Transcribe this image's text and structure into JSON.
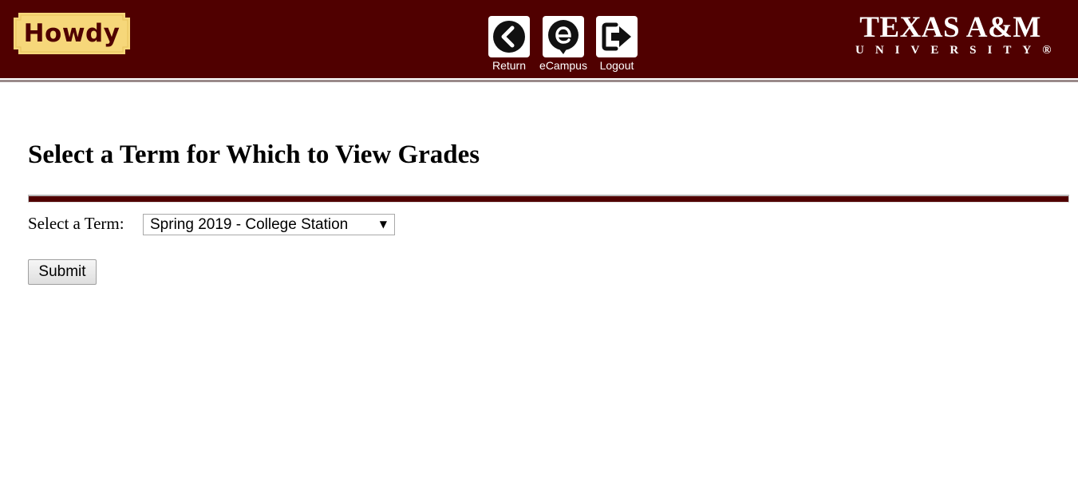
{
  "header": {
    "logo_text": "Howdy",
    "nav": [
      {
        "label": "Return",
        "icon": "chevron-left-circle-icon"
      },
      {
        "label": "eCampus",
        "icon": "ecampus-icon"
      },
      {
        "label": "Logout",
        "icon": "logout-arrow-icon"
      }
    ],
    "university_line1": "TEXAS A&M",
    "university_line2": "UNIVERSITY®"
  },
  "main": {
    "title": "Select a Term for Which to View Grades",
    "term_label": "Select a Term:",
    "term_selected": "Spring 2019 - College Station",
    "submit_label": "Submit"
  },
  "colors": {
    "maroon": "#500000",
    "howdy_gold": "#f6d77a"
  }
}
